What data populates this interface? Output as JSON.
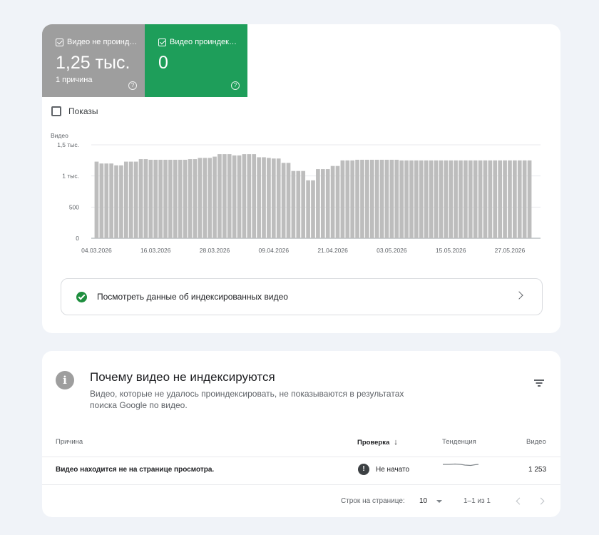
{
  "summary": {
    "not_indexed": {
      "label": "Видео не проинд…",
      "value": "1,25 тыс.",
      "sub": "1 причина"
    },
    "indexed": {
      "label": "Видео проиндек…",
      "value": "0"
    },
    "help_glyph": "?"
  },
  "impressions_label": "Показы",
  "chart_data": {
    "type": "bar",
    "ylabel": "Видео",
    "ylim": [
      0,
      1500
    ],
    "y_ticks": [
      "0",
      "500",
      "1 тыс.",
      "1,5 тыс."
    ],
    "y_tick_values": [
      0,
      500,
      1000,
      1500
    ],
    "x_ticks": [
      "04.03.2026",
      "16.03.2026",
      "28.03.2026",
      "09.04.2026",
      "21.04.2026",
      "03.05.2026",
      "15.05.2026",
      "27.05.2026"
    ],
    "x_tick_indices": [
      0,
      12,
      24,
      36,
      48,
      60,
      72,
      84
    ],
    "bar_color": "#bdbdbd",
    "series": [
      {
        "values": [
          1230,
          1200,
          1200,
          1200,
          1170,
          1170,
          1230,
          1230,
          1230,
          1270,
          1270,
          1260,
          1260,
          1260,
          1260,
          1260,
          1260,
          1260,
          1260,
          1270,
          1270,
          1290,
          1290,
          1290,
          1310,
          1350,
          1350,
          1350,
          1330,
          1330,
          1350,
          1350,
          1350,
          1300,
          1300,
          1290,
          1280,
          1280,
          1210,
          1210,
          1080,
          1080,
          1080,
          930,
          930,
          1110,
          1110,
          1110,
          1160,
          1160,
          1250,
          1250,
          1250,
          1260,
          1260,
          1260,
          1260,
          1260,
          1260,
          1260,
          1260,
          1260,
          1250,
          1250,
          1250,
          1250,
          1250,
          1250,
          1250,
          1250,
          1250,
          1250,
          1250,
          1250,
          1250,
          1250,
          1250,
          1250,
          1250,
          1250,
          1250,
          1250,
          1250,
          1250,
          1250,
          1250,
          1250,
          1250,
          1250
        ]
      }
    ]
  },
  "view_indexed_link": "Посмотреть данные об индексированных видео",
  "reasons": {
    "title": "Почему видео не индексируются",
    "description": "Видео, которые не удалось проиндексировать, не показываются в результатах поиска Google по видео.",
    "columns": {
      "reason": "Причина",
      "validation": "Проверка",
      "trend": "Тенденция",
      "videos": "Видео"
    },
    "rows": [
      {
        "reason": "Видео находится не на странице просмотра.",
        "validation": "Не начато",
        "videos": "1 253"
      }
    ],
    "warn_glyph": "!",
    "info_glyph": "i",
    "sort_glyph": "↓"
  },
  "pagination": {
    "rows_label": "Строк на странице:",
    "rows_value": "10",
    "range": "1–1 из 1"
  },
  "colors": {
    "accent_green": "#1e9e5a",
    "gray_box": "#9e9e9e",
    "page_bg": "#f0f3f8"
  }
}
